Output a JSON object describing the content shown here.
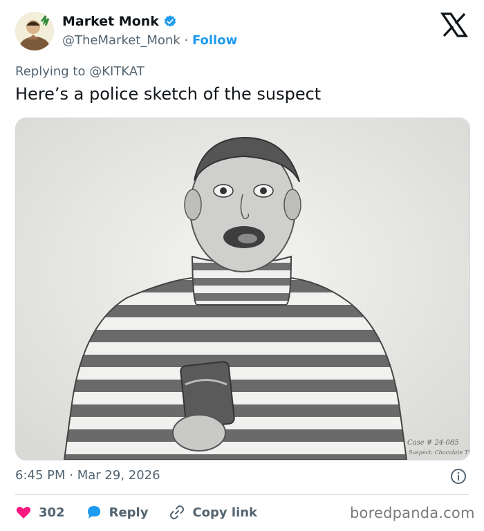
{
  "author": {
    "name": "Market Monk",
    "handle": "@TheMarket_Monk",
    "separator": "·",
    "follow_label": "Follow"
  },
  "reply_context": {
    "prefix": "Replying to ",
    "mention": "@KITKAT"
  },
  "tweet": {
    "text": "Here’s a police sketch of the suspect"
  },
  "media": {
    "case_line_1": "Case # 24-085",
    "case_line_2": "Suspect: Chocolate Theft"
  },
  "meta": {
    "time": "6:45 PM",
    "separator": "·",
    "date": "Mar 29, 2026"
  },
  "actions": {
    "like_count": "302",
    "reply_label": "Reply",
    "copy_label": "Copy link"
  },
  "watermark": "boredpanda.com",
  "colors": {
    "accent": "#1d9bf0",
    "like": "#f91880",
    "text": "#0f1419",
    "muted": "#536471"
  }
}
